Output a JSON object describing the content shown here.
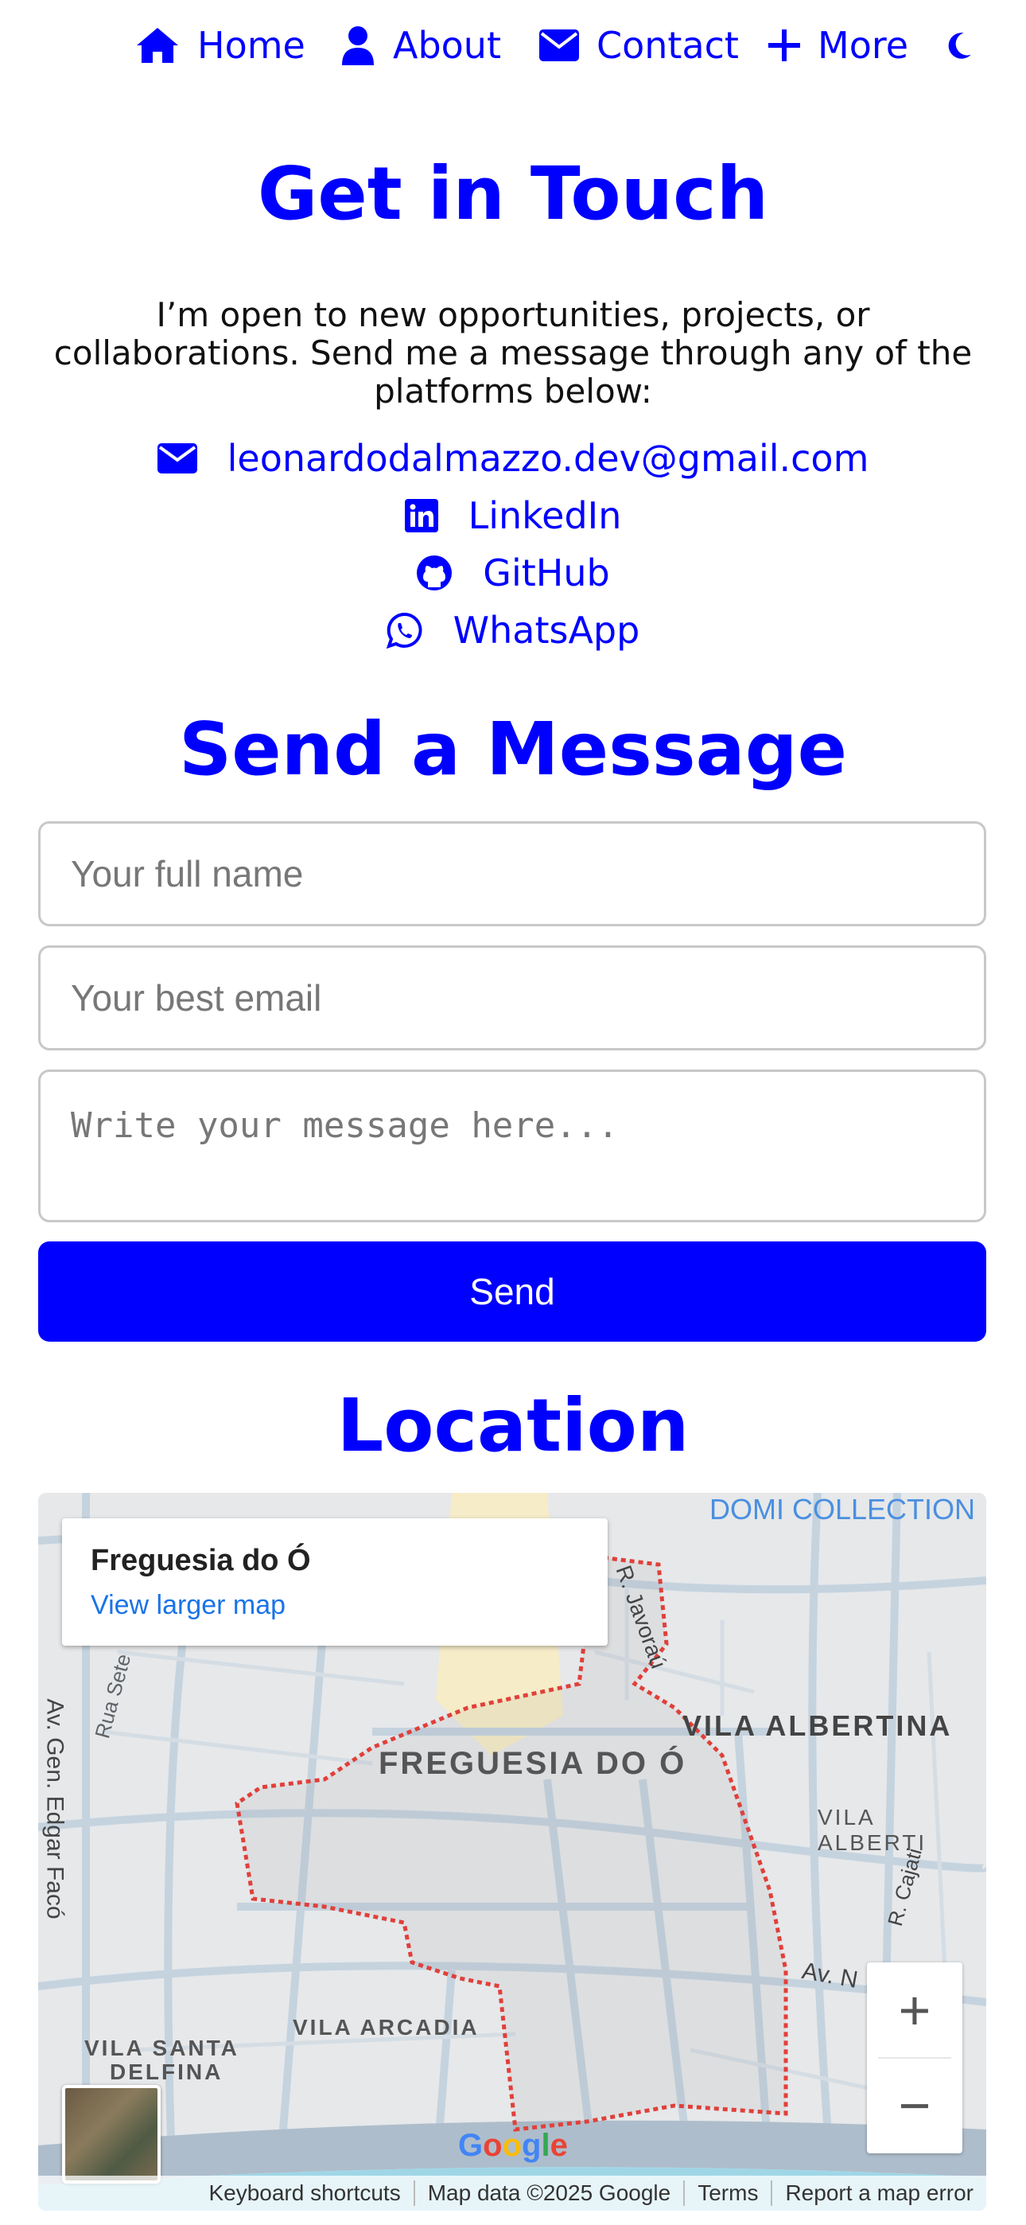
{
  "nav": {
    "home": "Home",
    "about": "About",
    "contact": "Contact",
    "more": "More",
    "icons": [
      "home-icon",
      "user-icon",
      "envelope-icon",
      "plus-icon",
      "moon-icon"
    ]
  },
  "contact_section": {
    "title": "Get in Touch",
    "intro": "I’m open to new opportunities, projects, or collaborations. Send me a message through any of the platforms below:",
    "links": {
      "email": "leonardodalmazzo.dev@gmail.com",
      "linkedin": "LinkedIn",
      "github": "GitHub",
      "whatsapp": "WhatsApp"
    }
  },
  "form": {
    "title": "Send a Message",
    "name_placeholder": "Your full name",
    "email_placeholder": "Your best email",
    "message_placeholder": "Write your message here...",
    "send_label": "Send"
  },
  "location": {
    "title": "Location",
    "map": {
      "place_name": "Freguesia do Ó",
      "larger_map": "View larger map",
      "labels": {
        "domi": "DOMI COLLECTION",
        "freguesia": "FREGUESIA DO Ó",
        "vila_albertina": "VILA ALBERTINA",
        "vila_alberti": "VILA ALBERTI",
        "vila_santa": "VILA SANTA",
        "delfina": "DELFINA",
        "vila_arcadia": "VILA ARCADIA",
        "rua_sete": "Rua Sete",
        "edgar_faco": "Av. Gen. Edgar Facó",
        "javorau": "R. Javoraú",
        "cajati": "R. Cajati",
        "av": "Av. N"
      },
      "zoom_in": "+",
      "zoom_out": "−",
      "google": "Google",
      "footer": {
        "shortcuts": "Keyboard shortcuts",
        "map_data": "Map data ©2025 Google",
        "terms": "Terms",
        "report": "Report a map error"
      }
    }
  },
  "colors": {
    "accent": "#0000ff",
    "border": "#c8c8c8",
    "map_bg": "#e4e6e8"
  }
}
